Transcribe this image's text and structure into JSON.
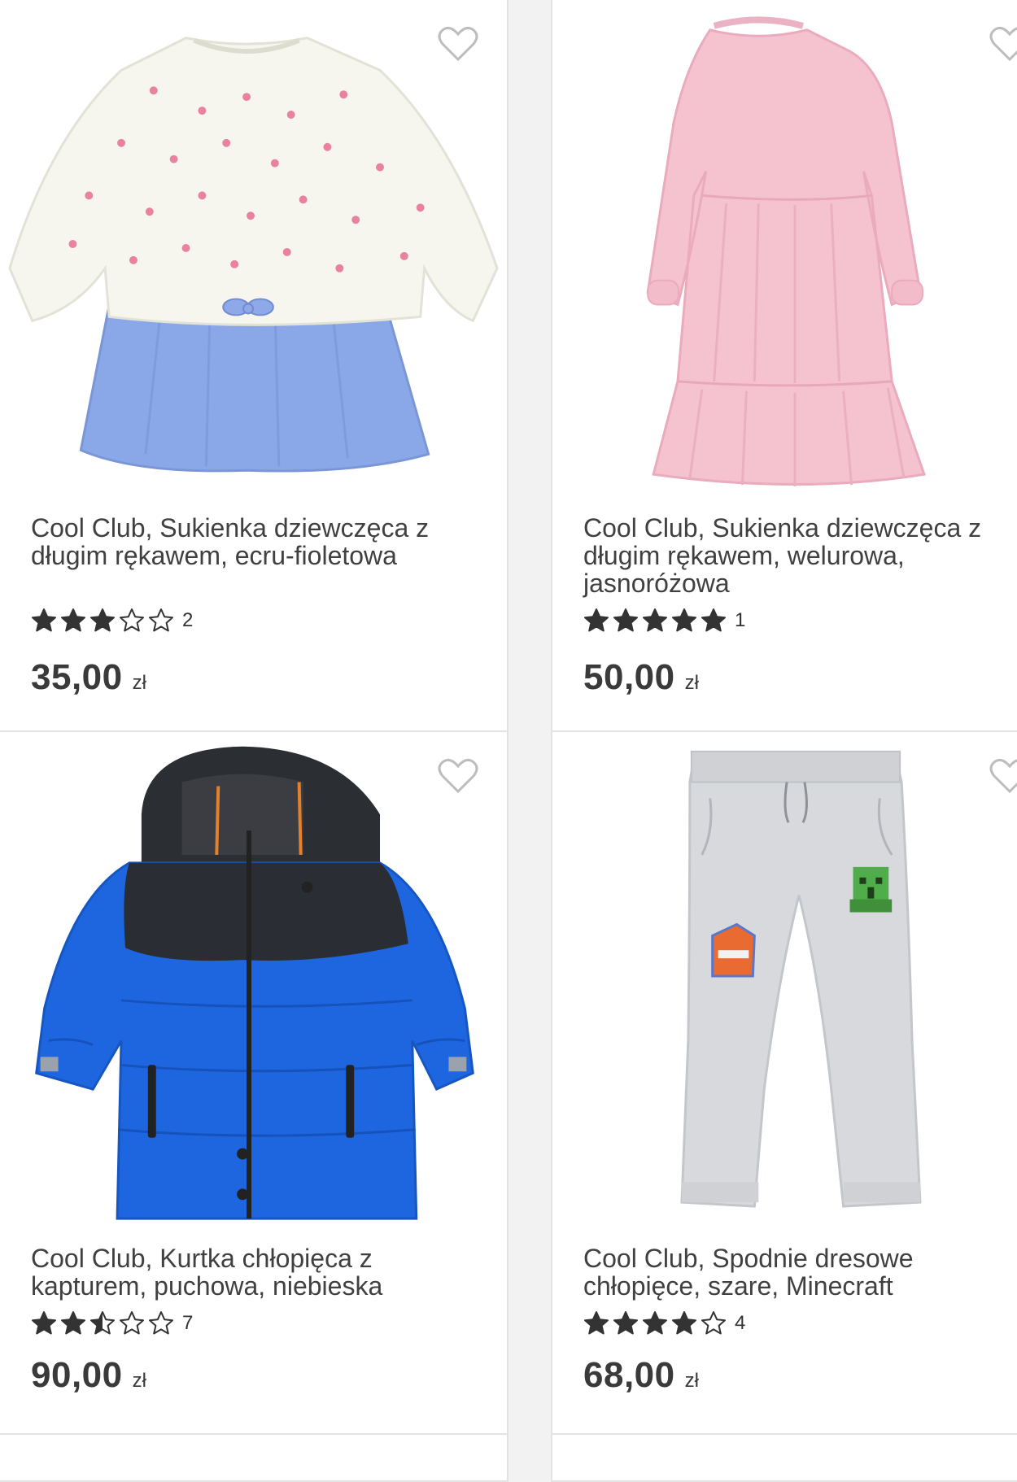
{
  "colors": {
    "card_bg": "#ffffff",
    "card_border": "#e3e3e3",
    "text": "#404040",
    "star": "#333333",
    "heart": "#bdbdbd"
  },
  "products": [
    {
      "title": "Cool Club, Sukienka dziewczęca z długim rękawem, ecru-fioletowa",
      "rating": 3,
      "rating_count": "2",
      "price": "35,00",
      "currency": "zł",
      "image_icon": "girl-dress-sweater-image"
    },
    {
      "title": "Cool Club, Sukienka dziewczęca z długim rękawem, welurowa, jasnoróżowa",
      "rating": 5,
      "rating_count": "1",
      "price": "50,00",
      "currency": "zł",
      "image_icon": "pink-dress-image"
    },
    {
      "title": "Cool Club, Kurtka chłopięca z kapturem, puchowa, niebieska",
      "rating": 2.5,
      "rating_count": "7",
      "price": "90,00",
      "currency": "zł",
      "image_icon": "blue-jacket-image"
    },
    {
      "title": "Cool Club, Spodnie dresowe chłopięce, szare, Minecraft",
      "rating": 4,
      "rating_count": "4",
      "price": "68,00",
      "currency": "zł",
      "image_icon": "grey-sweatpants-image"
    }
  ]
}
